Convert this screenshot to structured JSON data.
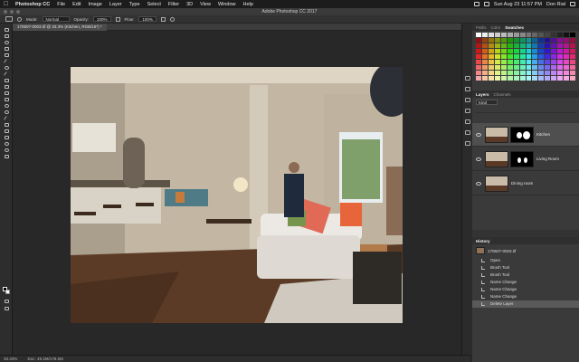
{
  "menubar": {
    "app": "Photoshop CC",
    "items": [
      "File",
      "Edit",
      "Image",
      "Layer",
      "Type",
      "Select",
      "Filter",
      "3D",
      "View",
      "Window",
      "Help"
    ],
    "clock": "Sun Aug 23 11:57 PM",
    "user": "Don Rial"
  },
  "window_title": "Adobe Photoshop CC 2017",
  "options": {
    "mode_label": "Mode:",
    "mode_value": "Normal",
    "opacity_label": "Opacity:",
    "opacity_value": "100%",
    "flow_label": "Flow:",
    "flow_value": "100%"
  },
  "document": {
    "tab_label": "170607-0003.tif @ 33.3% (Kitchen, RGB/16*) *"
  },
  "status": {
    "zoom": "33.33%",
    "doc": "Doc: 49.2M/178.5M"
  },
  "swatches_panel": {
    "tabs": [
      "Paths",
      "Color",
      "Swatches"
    ],
    "active": "Swatches"
  },
  "layers_panel": {
    "tabs": [
      "Layers",
      "Channels"
    ],
    "active": "Layers",
    "kind_label": "Kind",
    "layers": [
      {
        "name": "Kitchen",
        "has_mask": true,
        "selected": true
      },
      {
        "name": "Living Room",
        "has_mask": true,
        "selected": false
      },
      {
        "name": "Dining room",
        "has_mask": false,
        "selected": false
      }
    ]
  },
  "history_panel": {
    "title": "History",
    "snapshot": "170607-0003.tif",
    "steps": [
      "Open",
      "Brush Tool",
      "Brush Tool",
      "Name Change",
      "Name Change",
      "Name Change",
      "Delete Layer"
    ],
    "selected_index": 6
  },
  "colors": {
    "app_bg": "#262626",
    "panel_bg": "#3a3a3a",
    "selected_row": "#4f4f4f"
  }
}
